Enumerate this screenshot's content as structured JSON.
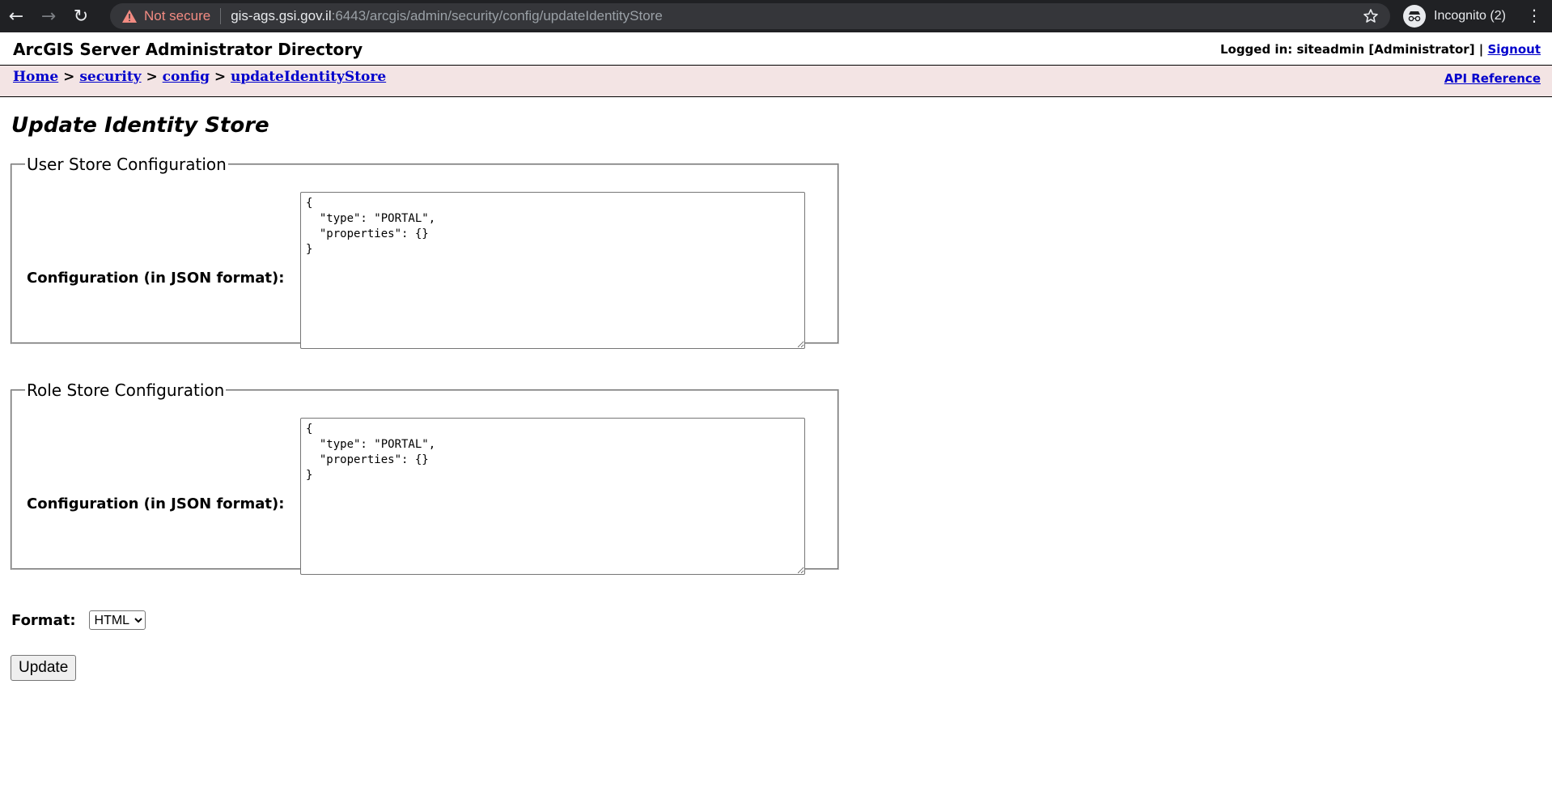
{
  "browser": {
    "security_label": "Not secure",
    "url_host": "gis-ags.gsi.gov.il",
    "url_rest": ":6443/arcgis/admin/security/config/updateIdentityStore",
    "incognito_label": "Incognito (2)"
  },
  "header": {
    "title": "ArcGIS Server Administrator Directory",
    "login_text": "Logged in: siteadmin [Administrator] | ",
    "signout_label": "Signout"
  },
  "breadcrumb": {
    "items": [
      "Home",
      "security",
      "config",
      "updateIdentityStore"
    ],
    "separator": ">",
    "api_reference": "API Reference"
  },
  "page": {
    "title": "Update Identity Store"
  },
  "user_store": {
    "legend": "User Store Configuration",
    "label": "Configuration (in JSON format):",
    "value": "{\n  \"type\": \"PORTAL\",\n  \"properties\": {}\n}"
  },
  "role_store": {
    "legend": "Role Store Configuration",
    "label": "Configuration (in JSON format):",
    "value": "{\n  \"type\": \"PORTAL\",\n  \"properties\": {}\n}"
  },
  "format": {
    "label": "Format:",
    "selected": "HTML"
  },
  "actions": {
    "update_label": "Update"
  }
}
